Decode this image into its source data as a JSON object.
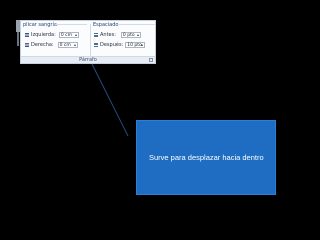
{
  "ribbon": {
    "indent": {
      "title": "plicar sangría",
      "left_label": "Izquierda:",
      "left_value": "0 cm",
      "right_label": "Derecha:",
      "right_value": "0 cm"
    },
    "spacing": {
      "title": "Espaciado",
      "before_label": "Antes:",
      "before_value": "0 pto",
      "after_label": "Después:",
      "after_value": "10 pto"
    },
    "group_label": "Párrafo"
  },
  "callout": {
    "text": "Surve para  desplazar hacia dentro",
    "fill_color": "#1E6DC2"
  },
  "icons": [
    "indent-left-icon",
    "indent-right-icon",
    "spacing-before-icon",
    "spacing-after-icon",
    "dialog-launcher-icon"
  ]
}
